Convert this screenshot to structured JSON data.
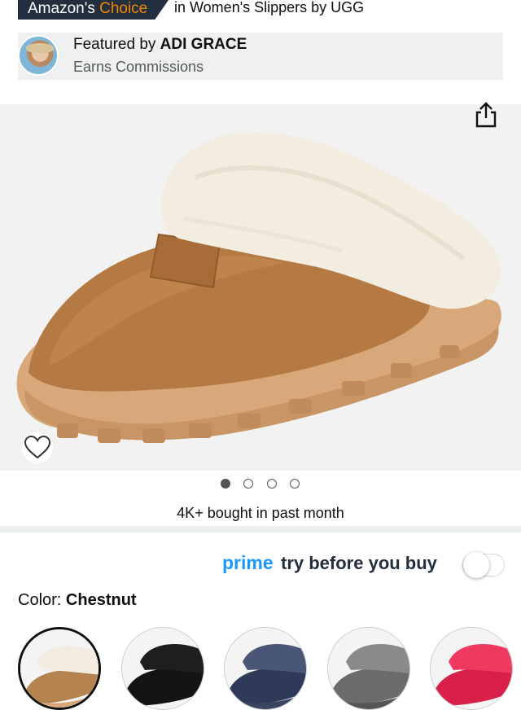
{
  "badge": {
    "prefix": "Amazon's ",
    "highlight": "Choice",
    "category": "in Women's Slippers by UGG"
  },
  "featured": {
    "label": "Featured by ",
    "name": "ADI GRACE",
    "note": "Earns Commissions"
  },
  "product_image": {
    "pagination_total": 4,
    "pagination_active": 1
  },
  "social_proof": {
    "bought": "4K+ bought in past month"
  },
  "prime": {
    "brand": "prime",
    "text": "try before you buy",
    "toggle_on": false
  },
  "color": {
    "label": "Color: ",
    "selected": "Chestnut",
    "swatches": [
      {
        "name": "Chestnut",
        "hex": "#b5834f",
        "fur": "#f3ece0"
      },
      {
        "name": "Black",
        "hex": "#141414",
        "fur": "#1e1e1e"
      },
      {
        "name": "Navy",
        "hex": "#2e3a58",
        "fur": "#4a5675"
      },
      {
        "name": "Grey",
        "hex": "#6b6b6b",
        "fur": "#8a8a8a"
      },
      {
        "name": "Pink",
        "hex": "#d8204a",
        "fur": "#ee3a5e"
      }
    ]
  },
  "icons": {
    "share": "share-icon",
    "wishlist": "heart-icon"
  },
  "colors": {
    "badge_bg": "#232f3e",
    "choice_orange": "#f08804",
    "prime_blue": "#1a98ff"
  }
}
